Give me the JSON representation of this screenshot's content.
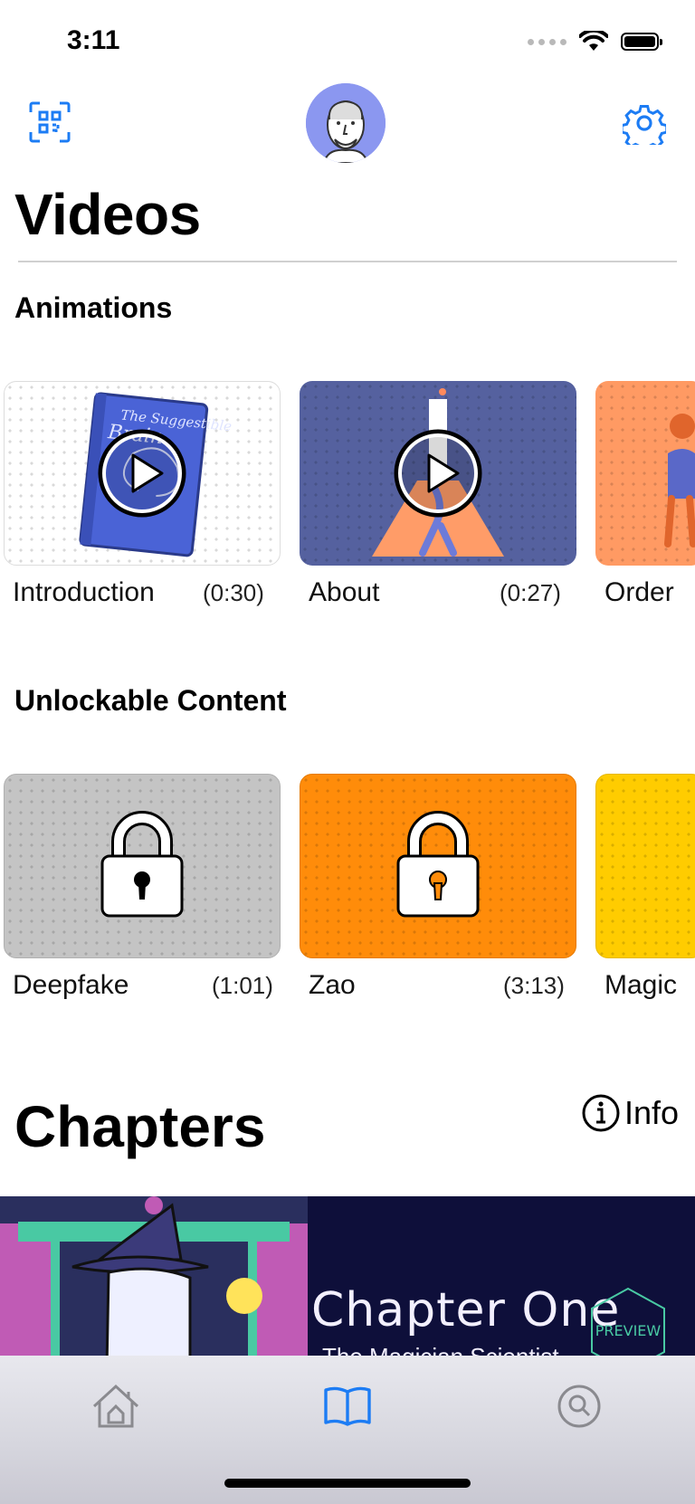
{
  "status": {
    "time": "3:11"
  },
  "header": {
    "title": "Videos"
  },
  "animations": {
    "title": "Animations",
    "items": [
      {
        "label": "Introduction",
        "duration": "(0:30)"
      },
      {
        "label": "About",
        "duration": "(0:27)"
      },
      {
        "label": "Order",
        "duration": ""
      }
    ]
  },
  "unlockable": {
    "title": "Unlockable Content",
    "items": [
      {
        "label": "Deepfake",
        "duration": "(1:01)"
      },
      {
        "label": "Zao",
        "duration": "(3:13)"
      },
      {
        "label": "Magic",
        "duration": ""
      }
    ]
  },
  "chapters": {
    "title": "Chapters",
    "info_label": "Info",
    "banner": {
      "title": "Chapter One",
      "subtitle": "The Magician Scientist",
      "badge": "PREVIEW"
    }
  },
  "book": {
    "title": "The Suggestible",
    "subtitle": "Brain"
  },
  "colors": {
    "accent": "#1c7cf4",
    "avatar_bg": "#8b97f0",
    "about_bg": "#55619f",
    "order_bg": "#ff9a63",
    "deepfake_bg": "#c4c4c4",
    "zao_bg": "#ff8c0a",
    "magic_bg": "#ffcc00",
    "banner_bg": "#0e0f3a"
  },
  "tabs": [
    {
      "name": "home-tab-icon",
      "active": false
    },
    {
      "name": "book-tab-icon",
      "active": true
    },
    {
      "name": "search-tab-icon",
      "active": false
    }
  ]
}
